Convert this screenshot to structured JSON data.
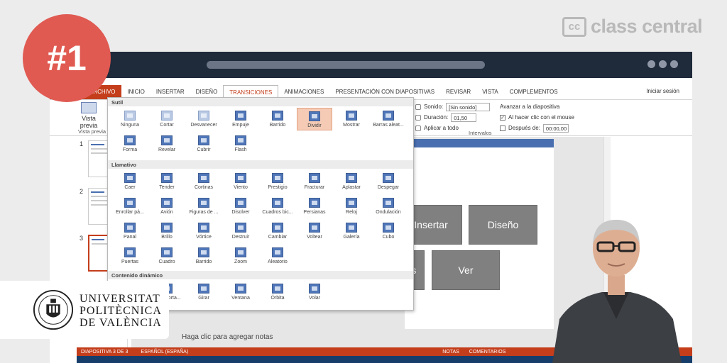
{
  "badge": "#1",
  "brand": {
    "box": "cc",
    "name": "class central"
  },
  "ppt": {
    "tabs": [
      {
        "label": "ARCHIVO",
        "kind": "file"
      },
      {
        "label": "INICIO"
      },
      {
        "label": "INSERTAR"
      },
      {
        "label": "DISEÑO"
      },
      {
        "label": "TRANSICIONES",
        "active": true
      },
      {
        "label": "ANIMACIONES"
      },
      {
        "label": "PRESENTACIÓN CON DIAPOSITIVAS"
      },
      {
        "label": "REVISAR"
      },
      {
        "label": "VISTA"
      },
      {
        "label": "COMPLEMENTOS"
      }
    ],
    "sign_in": "Iniciar sesión",
    "preview": {
      "label1": "Vista",
      "label2": "previa",
      "group": "Vista previa"
    },
    "timing": {
      "sound_label": "Sonido:",
      "sound_value": "[Sin sonido]",
      "duration_label": "Duración:",
      "duration_value": "01,50",
      "apply_all": "Aplicar a todo",
      "advance_title": "Avanzar a la diapositiva",
      "on_click": "Al hacer clic con el mouse",
      "after_label": "Después de:",
      "after_value": "00:00,00",
      "group": "Intervalos"
    },
    "thumbs": [
      {
        "num": "1"
      },
      {
        "num": "2"
      },
      {
        "num": "3"
      }
    ],
    "slide_buttons": [
      "Insertar",
      "Diseño",
      "es",
      "Ver"
    ],
    "notes": "Haga clic para agregar notas",
    "status": {
      "slide": "DIAPOSITIVA 3 DE 3",
      "lang": "ESPAÑOL (ESPAÑA)",
      "notes": "NOTAS",
      "comments": "COMENTARIOS"
    }
  },
  "gallery": {
    "sections": [
      {
        "title": "Sutil",
        "items": [
          "Ninguna",
          "Cortar",
          "Desvanecer",
          "Empuje",
          "Barrido",
          "Dividir",
          "Mostrar",
          "Barras aleat...",
          "Forma",
          "Revelar",
          "Cubrir",
          "Flash"
        ]
      },
      {
        "title": "Llamativo",
        "items": [
          "Caer",
          "Tender",
          "Cortinas",
          "Viento",
          "Prestigio",
          "Fracturar",
          "Aplastar",
          "Despegar",
          "Enrollar pá...",
          "Avión",
          "Figuras de ...",
          "Disolver",
          "Cuadros bic...",
          "Persianas",
          "Reloj",
          "Ondulación",
          "Panal",
          "Brillo",
          "Vórtice",
          "Destruir",
          "Cambiar",
          "Voltear",
          "Galería",
          "Cubo",
          "Puertas",
          "Cuadro",
          "Barrido",
          "Zoom",
          "Aleatorio"
        ]
      },
      {
        "title": "Contenido dinámico",
        "items": [
          "...agi...",
          "Transporta...",
          "Girar",
          "Ventana",
          "Órbita",
          "Volar"
        ]
      }
    ],
    "selected": "Dividir"
  },
  "upv": {
    "line1": "UNIVERSITAT",
    "line2": "POLITÈCNICA",
    "line3": "DE VALÈNCIA"
  }
}
